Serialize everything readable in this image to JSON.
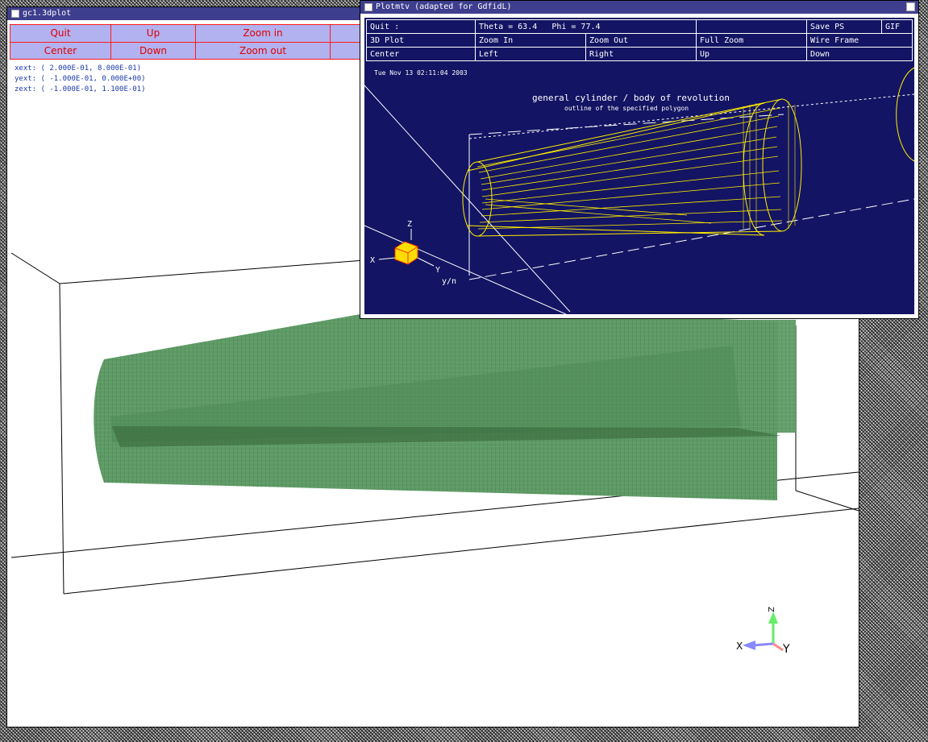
{
  "window1": {
    "title": "gc1.3dplot",
    "buttons": {
      "quit": "Quit",
      "up": "Up",
      "zoom_in": "Zoom in",
      "center": "Center",
      "down": "Down",
      "zoom_out": "Zoom out"
    },
    "extents": {
      "xext": "xext: (  2.000E-01,  8.000E-01)",
      "yext": "yext: ( -1.000E-01,  0.000E+00)",
      "zext": "zext: ( -1.000E-01,  1.100E-01)"
    },
    "axes": {
      "x": "X",
      "y": "Y",
      "z": "Z"
    },
    "colors": {
      "mesh": "#5e9a66",
      "button_bg": "#b2b2f0",
      "button_text": "#e00000"
    }
  },
  "window2": {
    "title": "Plotmtv (adapted for GdfidL)",
    "toolbar": {
      "quit": "Quit :",
      "theta": "Theta = 63.4",
      "phi": "Phi = 77.4",
      "save_ps": "Save PS",
      "gif": "GIF",
      "plot3d": "3D Plot",
      "zoom_in": "Zoom In",
      "zoom_out": "Zoom Out",
      "full_zoom": "Full Zoom",
      "wire_frame": "Wire Frame",
      "center": "Center",
      "left": "Left",
      "right": "Right",
      "up": "Up",
      "down": "Down"
    },
    "timestamp": "Tue Nov 13 02:11:04 2003",
    "plot_title": "general cylinder / body of revolution",
    "plot_subtitle": "outline of the specified polygon",
    "axes": {
      "x": "X",
      "y": "Y",
      "z": "Z",
      "extra": "y/n"
    },
    "colors": {
      "background": "#131463",
      "wire": "#ffee00"
    }
  }
}
